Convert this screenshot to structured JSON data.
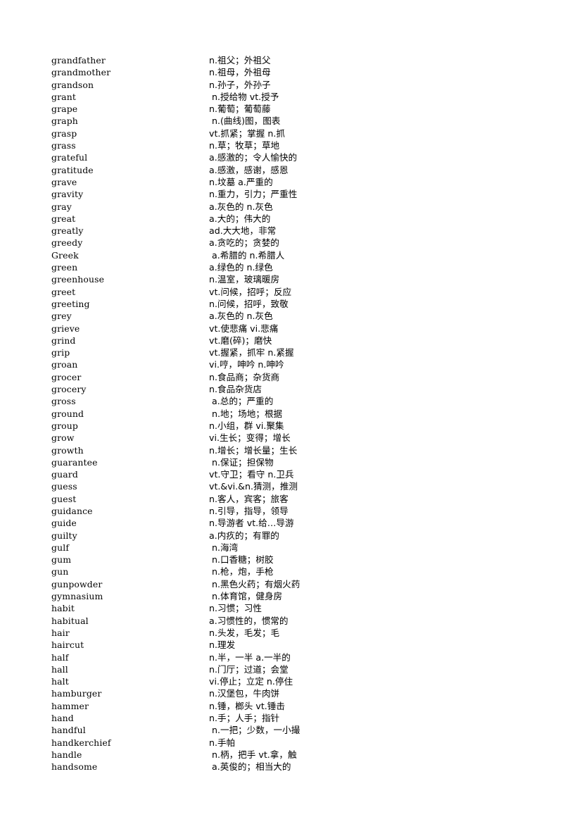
{
  "page": {
    "background_color": "#ffffff",
    "text_color": "#000000",
    "content_type": "bilingual-vocabulary-list",
    "columns": [
      "term",
      "definition"
    ]
  },
  "entries": [
    {
      "term": "grandfather",
      "definition": "n.祖父；外祖父"
    },
    {
      "term": "grandmother",
      "definition": "n.祖母，外祖母"
    },
    {
      "term": "grandson",
      "definition": "n.孙子，外孙子"
    },
    {
      "term": "grant",
      "definition": " n.授给物 vt.授予"
    },
    {
      "term": "grape",
      "definition": "n.葡萄；葡萄藤"
    },
    {
      "term": "graph",
      "definition": " n.(曲线)图，图表"
    },
    {
      "term": "grasp",
      "definition": "vt.抓紧；掌握 n.抓"
    },
    {
      "term": "grass",
      "definition": "n.草；牧草；草地"
    },
    {
      "term": "grateful",
      "definition": "a.感激的；令人愉快的"
    },
    {
      "term": "gratitude",
      "definition": "a.感激，感谢，感恩"
    },
    {
      "term": "grave",
      "definition": "n.坟墓 a.严重的"
    },
    {
      "term": "gravity",
      "definition": "n.重力，引力；严重性"
    },
    {
      "term": "gray",
      "definition": "a.灰色的 n.灰色"
    },
    {
      "term": "great",
      "definition": "a.大的；伟大的"
    },
    {
      "term": "greatly",
      "definition": "ad.大大地，非常"
    },
    {
      "term": "greedy",
      "definition": "a.贪吃的；贪婪的"
    },
    {
      "term": "Greek",
      "definition": " a.希腊的 n.希腊人"
    },
    {
      "term": "green",
      "definition": "a.绿色的 n.绿色"
    },
    {
      "term": "greenhouse",
      "definition": "n.温室，玻璃暖房"
    },
    {
      "term": "greet",
      "definition": "vt.问候，招呼；反应"
    },
    {
      "term": "greeting",
      "definition": "n.问候，招呼，致敬"
    },
    {
      "term": "grey",
      "definition": "a.灰色的 n.灰色"
    },
    {
      "term": "grieve",
      "definition": "vt.使悲痛 vi.悲痛"
    },
    {
      "term": "grind",
      "definition": "vt.磨(碎)；磨快"
    },
    {
      "term": "grip",
      "definition": "vt.握紧，抓牢 n.紧握"
    },
    {
      "term": "groan",
      "definition": "vi.哼，呻吟 n.呻吟"
    },
    {
      "term": "grocer",
      "definition": "n.食品商；杂货商"
    },
    {
      "term": "grocery",
      "definition": "n.食品杂货店"
    },
    {
      "term": "gross",
      "definition": " a.总的；严重的"
    },
    {
      "term": "ground",
      "definition": " n.地；场地；根据"
    },
    {
      "term": "group",
      "definition": "n.小组，群 vi.聚集"
    },
    {
      "term": "grow",
      "definition": "vi.生长；变得；增长"
    },
    {
      "term": "growth",
      "definition": "n.增长；增长量；生长"
    },
    {
      "term": "guarantee",
      "definition": " n.保证；担保物"
    },
    {
      "term": "guard",
      "definition": "vt.守卫；看守 n.卫兵"
    },
    {
      "term": "guess",
      "definition": "vt.&vi.&n.猜测，推测"
    },
    {
      "term": "guest",
      "definition": "n.客人，宾客；旅客"
    },
    {
      "term": "guidance",
      "definition": "n.引导，指导，领导"
    },
    {
      "term": "guide",
      "definition": "n.导游者 vt.给…导游"
    },
    {
      "term": "guilty",
      "definition": "a.内疚的；有罪的"
    },
    {
      "term": "gulf",
      "definition": " n.海湾"
    },
    {
      "term": "gum",
      "definition": " n.口香糖；树胶"
    },
    {
      "term": "gun",
      "definition": " n.枪，炮，手枪"
    },
    {
      "term": "gunpowder",
      "definition": " n.黑色火药；有烟火药"
    },
    {
      "term": "gymnasium",
      "definition": " n.体育馆，健身房"
    },
    {
      "term": "habit",
      "definition": "n.习惯；习性"
    },
    {
      "term": "habitual",
      "definition": "a.习惯性的，惯常的"
    },
    {
      "term": "hair",
      "definition": "n.头发，毛发；毛"
    },
    {
      "term": "haircut",
      "definition": "n.理发"
    },
    {
      "term": "half",
      "definition": "n.半，一半 a.一半的"
    },
    {
      "term": "hall",
      "definition": "n.门厅；过道；会堂"
    },
    {
      "term": "halt",
      "definition": "vi.停止；立定 n.停住"
    },
    {
      "term": "hamburger",
      "definition": "n.汉堡包，牛肉饼"
    },
    {
      "term": "hammer",
      "definition": "n.锤，榔头 vt.锤击"
    },
    {
      "term": "hand",
      "definition": "n.手；人手；指针"
    },
    {
      "term": "handful",
      "definition": " n.一把；少数，一小撮"
    },
    {
      "term": "handkerchief",
      "definition": "n.手帕"
    },
    {
      "term": "handle",
      "definition": " n.柄，把手 vt.拿，触"
    },
    {
      "term": "handsome",
      "definition": " a.英俊的；相当大的"
    }
  ]
}
